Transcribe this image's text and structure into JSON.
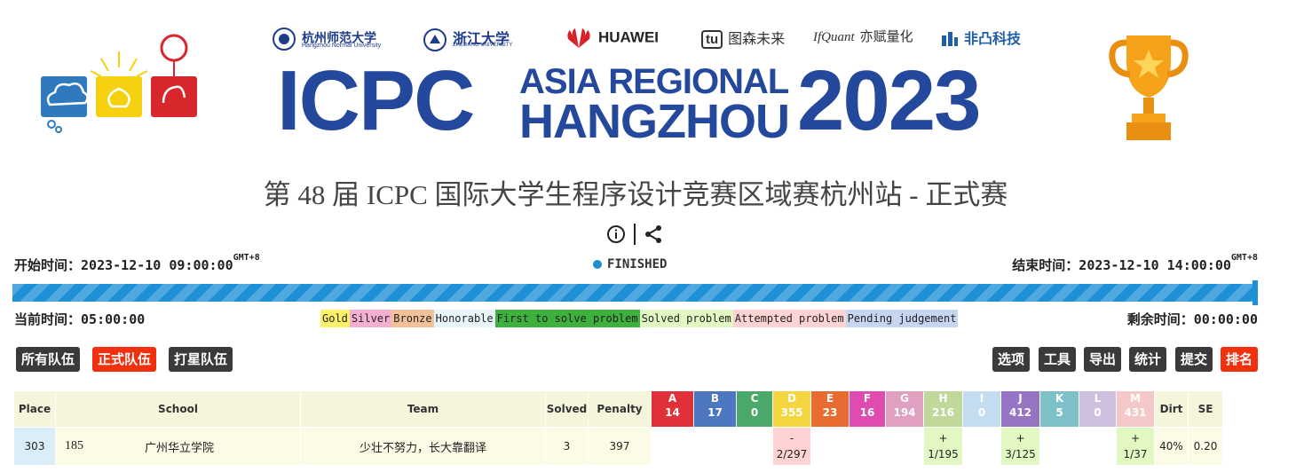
{
  "banner": {
    "sponsors": [
      {
        "name": "杭州师范大学",
        "sub": "Hangzhou Normal University"
      },
      {
        "name": "浙江大学",
        "sub": "ZHEJIANG UNIVERSITY"
      },
      {
        "name": "HUAWEI"
      },
      {
        "name": "图森未来",
        "mark": "tu"
      },
      {
        "name": "亦赋量化",
        "mark": "IfQuant"
      },
      {
        "name": "非凸科技"
      }
    ],
    "icpc": "ICPC",
    "asia_regional": "ASIA REGIONAL",
    "city": "HANGZHOU",
    "year": "2023"
  },
  "contest_title": "第 48 届 ICPC 国际大学生程序设计竞赛区域赛杭州站 - 正式赛",
  "icons": [
    "info-icon",
    "share-icon"
  ],
  "times": {
    "start_label": "开始时间：",
    "start_value": "2023-12-10 09:00:00",
    "end_label": "结束时间：",
    "end_value": "2023-12-10 14:00:00",
    "gmt": "GMT+8",
    "status": "FINISHED",
    "current_label": "当前时间：",
    "current_value": "05:00:00",
    "remaining_label": "剩余时间：",
    "remaining_value": "00:00:00",
    "progress": 1.0
  },
  "legend": [
    {
      "label": "Gold",
      "color": "#fff06a"
    },
    {
      "label": "Silver",
      "color": "#f5b0d0"
    },
    {
      "label": "Bronze",
      "color": "#f2c19a"
    },
    {
      "label": "Honorable",
      "color": "#e8f5fb"
    },
    {
      "label": "First to solve problem",
      "color": "#3db03d"
    },
    {
      "label": "Solved problem",
      "color": "#e2f8c2"
    },
    {
      "label": "Attempted problem",
      "color": "#ffd3d3"
    },
    {
      "label": "Pending judgement",
      "color": "#c6d5f0"
    }
  ],
  "left_buttons": [
    "所有队伍",
    "正式队伍",
    "打星队伍"
  ],
  "right_buttons": [
    "选项",
    "工具",
    "导出",
    "统计",
    "提交",
    "排名"
  ],
  "table": {
    "headers": {
      "place": "Place",
      "school": "School",
      "team": "Team",
      "solved": "Solved",
      "penalty": "Penalty",
      "dirt": "Dirt",
      "se": "SE"
    },
    "problems": [
      {
        "id": "A",
        "count": "14",
        "color": "#e0303a"
      },
      {
        "id": "B",
        "count": "17",
        "color": "#4d78c0"
      },
      {
        "id": "C",
        "count": "0",
        "color": "#4aa86a"
      },
      {
        "id": "D",
        "count": "355",
        "color": "#f5d640"
      },
      {
        "id": "E",
        "count": "23",
        "color": "#e86c32"
      },
      {
        "id": "F",
        "count": "16",
        "color": "#e04bb0"
      },
      {
        "id": "G",
        "count": "194",
        "color": "#e0a0c2"
      },
      {
        "id": "H",
        "count": "216",
        "color": "#c0d89a"
      },
      {
        "id": "I",
        "count": "0",
        "color": "#c4dcf0"
      },
      {
        "id": "J",
        "count": "412",
        "color": "#9674c4"
      },
      {
        "id": "K",
        "count": "5",
        "color": "#7cc2c8"
      },
      {
        "id": "L",
        "count": "0",
        "color": "#d0c0e0"
      },
      {
        "id": "M",
        "count": "431",
        "color": "#f4c8c8"
      }
    ],
    "rows": [
      {
        "place": "303",
        "school_id": "185",
        "school": "广州华立学院",
        "team": "少壮不努力，长大靠翻译",
        "solved": "3",
        "penalty": "397",
        "cells": [
          {
            "s": "empty"
          },
          {
            "s": "empty"
          },
          {
            "s": "empty"
          },
          {
            "s": "att",
            "mark": "-",
            "val": "2/297"
          },
          {
            "s": "empty"
          },
          {
            "s": "empty"
          },
          {
            "s": "empty"
          },
          {
            "s": "sol",
            "mark": "+",
            "val": "1/195"
          },
          {
            "s": "empty"
          },
          {
            "s": "sol",
            "mark": "+",
            "val": "3/125"
          },
          {
            "s": "empty"
          },
          {
            "s": "empty"
          },
          {
            "s": "sol",
            "mark": "+",
            "val": "1/37"
          }
        ],
        "dirt": "40%",
        "se": "0.20"
      }
    ]
  }
}
